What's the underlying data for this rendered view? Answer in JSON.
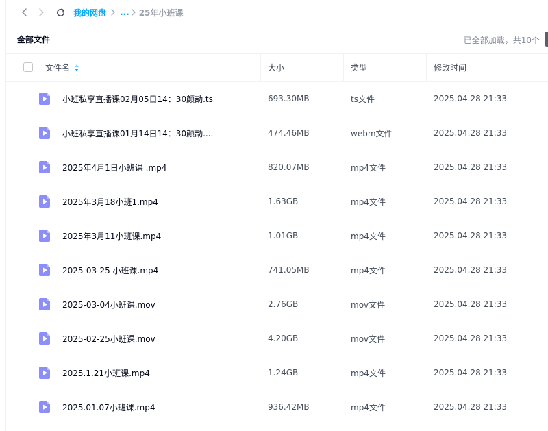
{
  "breadcrumb": {
    "root": "我的网盘",
    "ellipsis": "...",
    "current": "25年小班课"
  },
  "toolbar": {
    "all_files": "全部文件",
    "load_status": "已全部加载，共10个"
  },
  "columns": {
    "name": "文件名",
    "size": "大小",
    "type": "类型",
    "modified": "修改时间"
  },
  "colors": {
    "accent": "#06a7ff",
    "video_icon": "#8c8efc",
    "text": "#03081a"
  },
  "files": [
    {
      "name": "小班私享直播课02月05日14：30颜劼.ts",
      "size": "693.30MB",
      "type": "ts文件",
      "modified": "2025.04.28 21:33",
      "icon": "video-file-icon"
    },
    {
      "name": "小班私享直播课01月14日14：30颜劼....",
      "size": "474.46MB",
      "type": "webm文件",
      "modified": "2025.04.28 21:33",
      "icon": "video-file-icon"
    },
    {
      "name": "2025年4月1日小班课 .mp4",
      "size": "820.07MB",
      "type": "mp4文件",
      "modified": "2025.04.28 21:33",
      "icon": "video-file-icon"
    },
    {
      "name": "2025年3月18小班1.mp4",
      "size": "1.63GB",
      "type": "mp4文件",
      "modified": "2025.04.28 21:33",
      "icon": "video-file-icon"
    },
    {
      "name": "2025年3月11小班课.mp4",
      "size": "1.01GB",
      "type": "mp4文件",
      "modified": "2025.04.28 21:33",
      "icon": "video-file-icon"
    },
    {
      "name": "2025-03-25 小班课.mp4",
      "size": "741.05MB",
      "type": "mp4文件",
      "modified": "2025.04.28 21:33",
      "icon": "video-file-icon"
    },
    {
      "name": "2025-03-04小班课.mov",
      "size": "2.76GB",
      "type": "mov文件",
      "modified": "2025.04.28 21:33",
      "icon": "video-file-icon"
    },
    {
      "name": "2025-02-25小班课.mov",
      "size": "4.20GB",
      "type": "mov文件",
      "modified": "2025.04.28 21:33",
      "icon": "video-file-icon"
    },
    {
      "name": "2025.1.21小班课.mp4",
      "size": "1.24GB",
      "type": "mp4文件",
      "modified": "2025.04.28 21:33",
      "icon": "video-file-icon"
    },
    {
      "name": "2025.01.07小班课.mp4",
      "size": "936.42MB",
      "type": "mp4文件",
      "modified": "2025.04.28 21:33",
      "icon": "video-file-icon"
    }
  ]
}
